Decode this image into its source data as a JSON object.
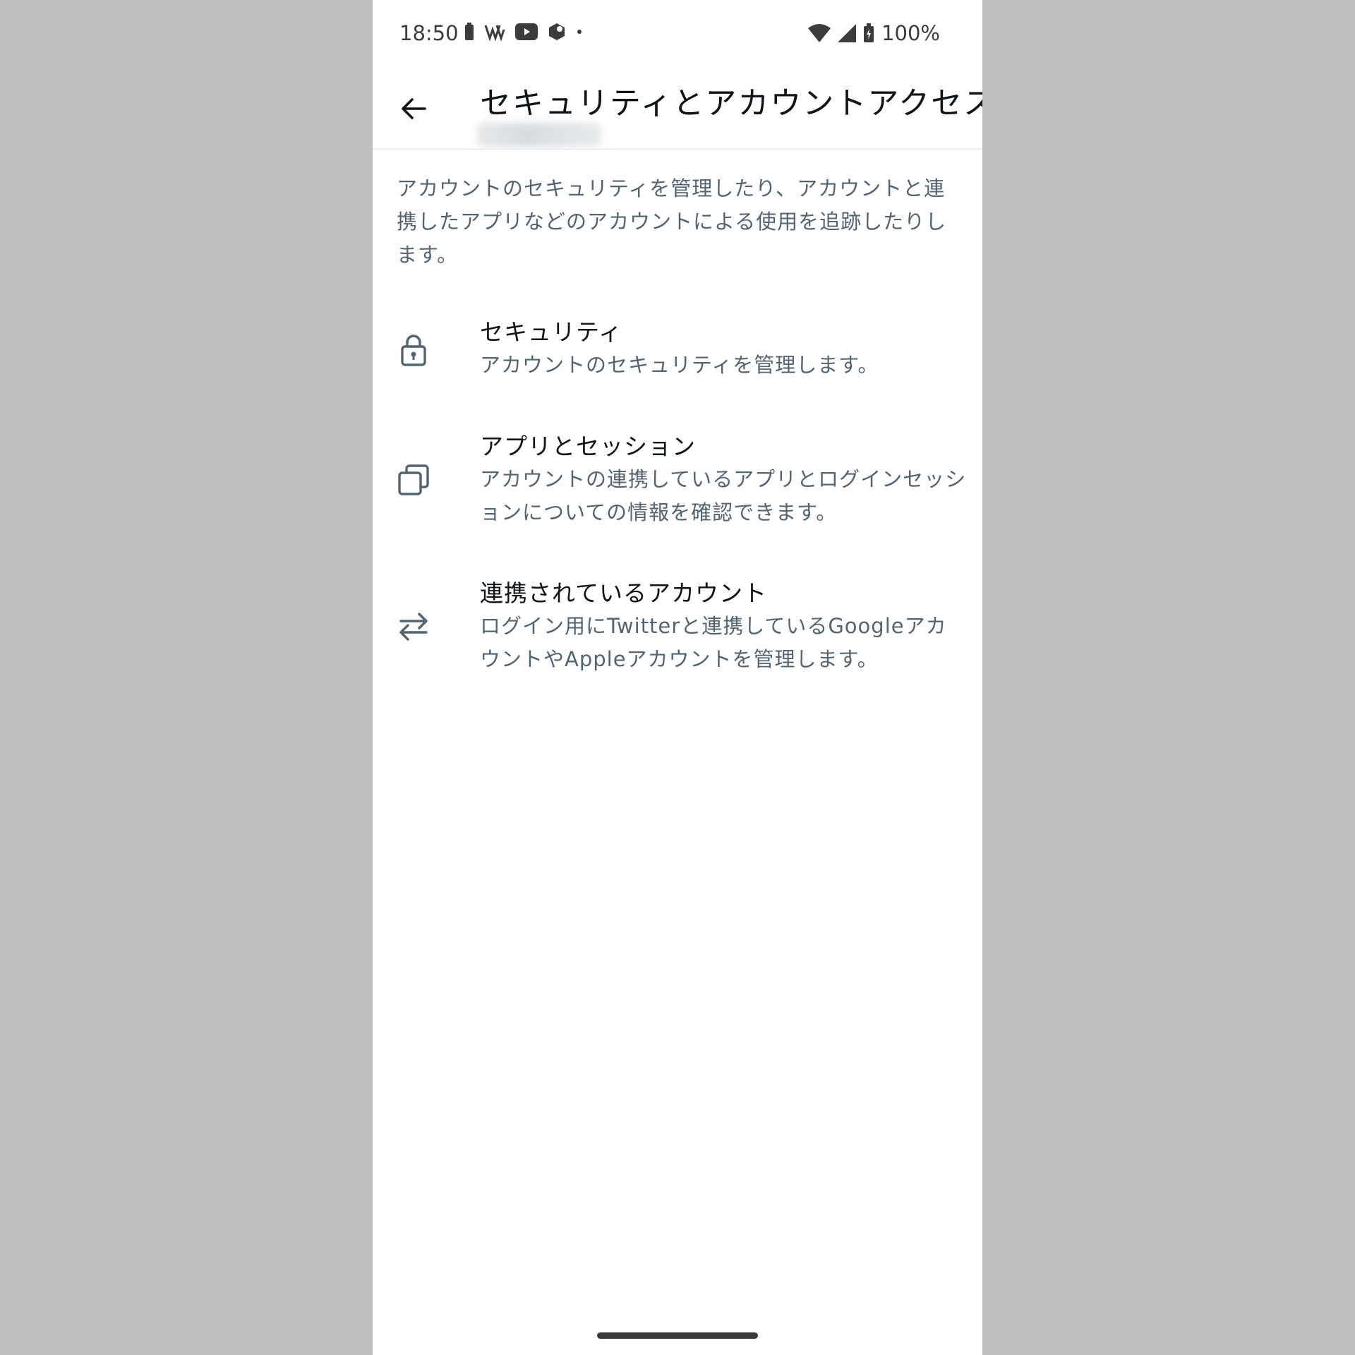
{
  "status_bar": {
    "time": "18:50",
    "battery_text": "100%",
    "left_icons": [
      "battery-saver-icon",
      "notification-app-icon",
      "youtube-icon",
      "app-icon",
      "more-dot-icon"
    ],
    "right_icons": [
      "wifi-icon",
      "signal-icon",
      "battery-charging-icon"
    ]
  },
  "header": {
    "title": "セキュリティとアカウントアクセス",
    "subtitle_redacted": true
  },
  "description": "アカウントのセキュリティを管理したり、アカウントと連携したアプリなどのアカウントによる使用を追跡したりします。",
  "menu": {
    "items": [
      {
        "icon": "lock-icon",
        "title": "セキュリティ",
        "desc": "アカウントのセキュリティを管理します。"
      },
      {
        "icon": "windows-icon",
        "title": "アプリとセッション",
        "desc": "アカウントの連携しているアプリとログインセッションについての情報を確認できます。"
      },
      {
        "icon": "swap-arrows-icon",
        "title": "連携されているアカウント",
        "desc": "ログイン用にTwitterと連携しているGoogleアカウントやAppleアカウントを管理します。"
      }
    ]
  },
  "colors": {
    "primary_text": "#0f1419",
    "secondary_text": "#536471",
    "background": "#ffffff",
    "outer_background": "#c0c0c0"
  }
}
